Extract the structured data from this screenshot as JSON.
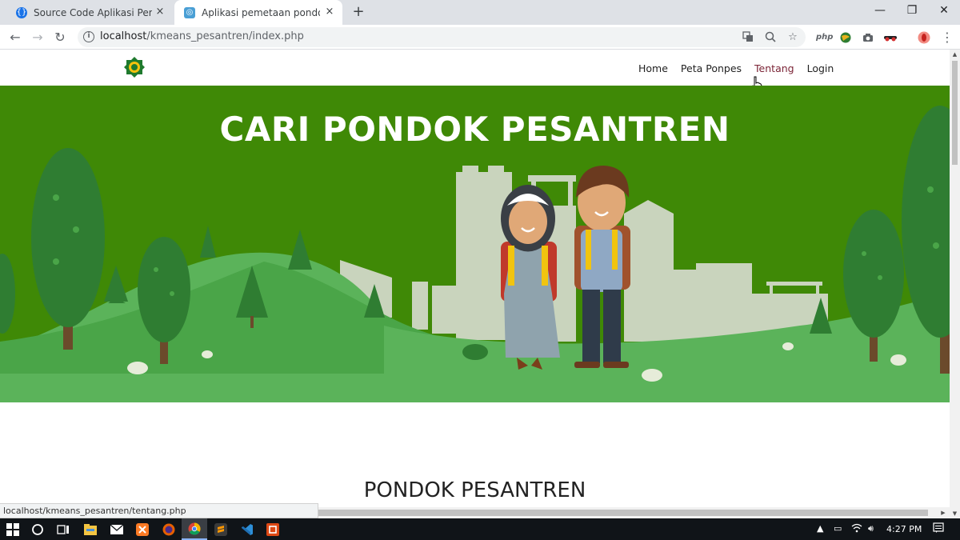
{
  "browser": {
    "tabs": [
      {
        "title": "Source Code Aplikasi Pemetaan Pondok Pesantren",
        "close": "×",
        "active": false
      },
      {
        "title": "Aplikasi pemetaan pondok pesantren",
        "close": "×",
        "active": true
      }
    ],
    "new_tab": "+",
    "window_controls": {
      "minimize": "—",
      "restore": "❐",
      "close": "✕"
    },
    "nav": {
      "back": "←",
      "forward": "→",
      "reload": "↻"
    },
    "url_host": "localhost",
    "url_path": "/kmeans_pesantren/index.php",
    "omnibox_icons": [
      "translate-icon",
      "zoom-icon",
      "star-icon"
    ],
    "extensions": {
      "php_label": "php"
    },
    "menu_glyph": "⋮"
  },
  "site": {
    "menu": [
      "Home",
      "Peta Ponpes",
      "Tentang",
      "Login"
    ],
    "hovered_item": "Tentang",
    "hero_title": "CARI PONDOK PESANTREN",
    "section_title": "PONDOK PESANTREN"
  },
  "status_bar": {
    "url": "localhost/kmeans_pesantren/tentang.php"
  },
  "taskbar": {
    "time": "4:27 PM",
    "apps": [
      "windows-start",
      "search",
      "task-view",
      "file-explorer",
      "mail",
      "xampp",
      "firefox",
      "chrome",
      "sublime-text",
      "vscode",
      "codeigniter"
    ],
    "active_app": "chrome"
  },
  "colors": {
    "hero_bg": "#3f8906",
    "hill_light": "#5bb35a",
    "city_silhouette": "#c9d4bd",
    "menu_hover": "#7b2436"
  }
}
